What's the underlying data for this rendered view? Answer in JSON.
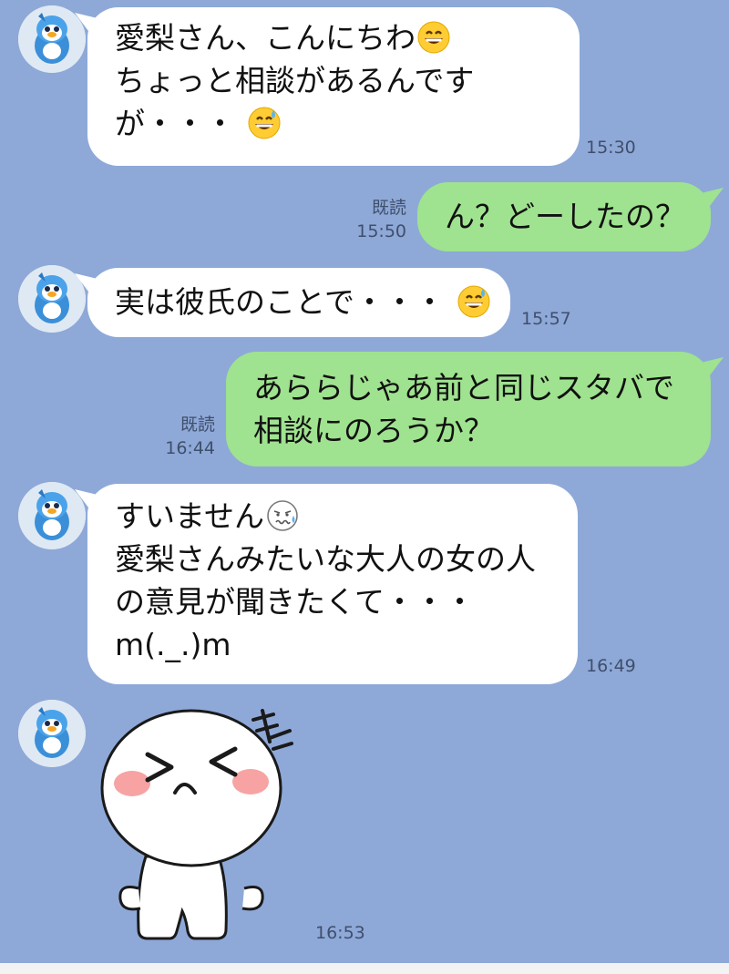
{
  "messages": [
    {
      "id": "m1",
      "direction": "in",
      "lines": [
        "愛梨さん、こんにちわ",
        "ちょっと相談があるんです",
        "が・・・"
      ],
      "time": "15:30"
    },
    {
      "id": "m2",
      "direction": "out",
      "lines": [
        "ん？どーしたの？"
      ],
      "read": "既読",
      "time": "15:50"
    },
    {
      "id": "m3",
      "direction": "in",
      "lines": [
        "実は彼氏のことで・・・"
      ],
      "time": "15:57"
    },
    {
      "id": "m4",
      "direction": "out",
      "lines": [
        "あららじゃあ前と同じスタバで",
        "相談にのろうか？"
      ],
      "read": "既読",
      "time": "16:44"
    },
    {
      "id": "m5",
      "direction": "in",
      "lines": [
        "すいません",
        "愛梨さんみたいな大人の女の人",
        "の意見が聞きたくて・・・",
        "m(._.)m"
      ],
      "time": "16:49"
    },
    {
      "id": "m6",
      "direction": "in",
      "type": "sticker",
      "sticker_icon": "laughing-face-sticker",
      "time": "16:53"
    }
  ],
  "colors": {
    "background": "#8ea9d8",
    "incoming_bubble": "#ffffff",
    "outgoing_bubble": "#9fe28f"
  },
  "icons": {
    "avatar": "penguin-avatar-icon",
    "grin": "grinning-emoji-icon",
    "sweat_smile": "sweat-smile-emoji-icon",
    "anxious": "anxious-emoji-icon"
  }
}
